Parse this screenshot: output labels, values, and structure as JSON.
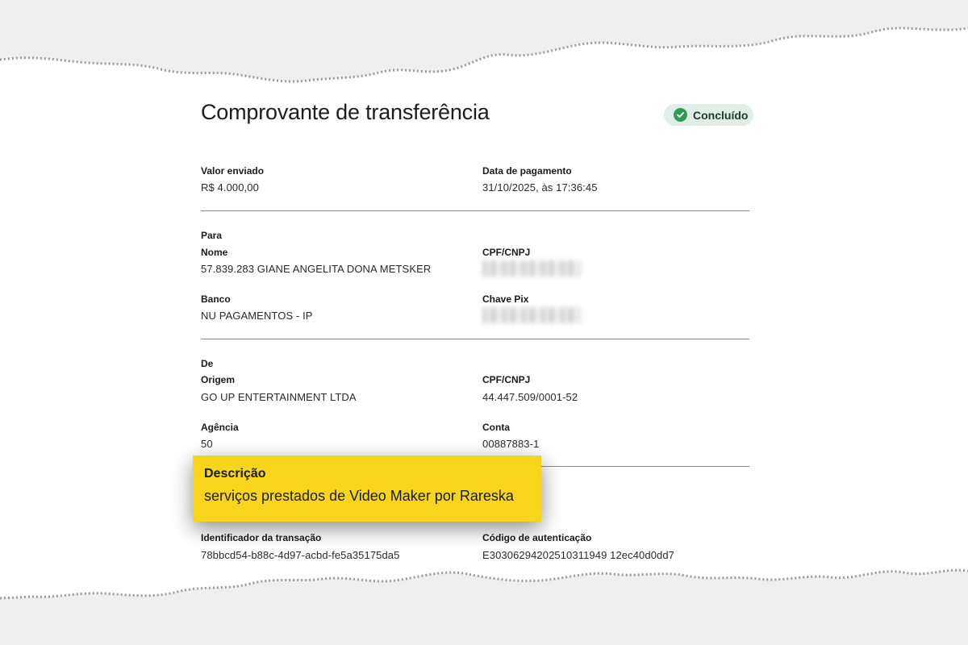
{
  "header": {
    "title": "Comprovante de transferência",
    "status": "Concluído",
    "status_color": "#2f9a58"
  },
  "summary": {
    "amount_label": "Valor enviado",
    "amount_value": "R$ 4.000,00",
    "date_label": "Data de pagamento",
    "date_value": "31/10/2025, às 17:36:45"
  },
  "recipient": {
    "section": "Para",
    "name_label": "Nome",
    "name_value": "57.839.283 GIANE ANGELITA DONA METSKER",
    "doc_label": "CPF/CNPJ",
    "bank_label": "Banco",
    "bank_value": "NU PAGAMENTOS - IP",
    "pix_label": "Chave Pix"
  },
  "sender": {
    "section": "De",
    "origin_label": "Origem",
    "origin_value": "GO UP ENTERTAINMENT LTDA",
    "doc_label": "CPF/CNPJ",
    "doc_value": "44.447.509/0001-52",
    "agency_label": "Agência",
    "agency_value": "50",
    "account_label": "Conta",
    "account_value": "00887883-1"
  },
  "description": {
    "label": "Descrição",
    "value": "serviços prestados de Video Maker por Rareska",
    "highlight_color": "#f8d51c"
  },
  "footer": {
    "txid_label": "Identificador da transação",
    "txid_value": "78bbcd54-b88c-4d97-acbd-fe5a35175da5",
    "auth_label": "Código de autenticação",
    "auth_value": "E30306294202510311949 12ec40d0dd7"
  }
}
